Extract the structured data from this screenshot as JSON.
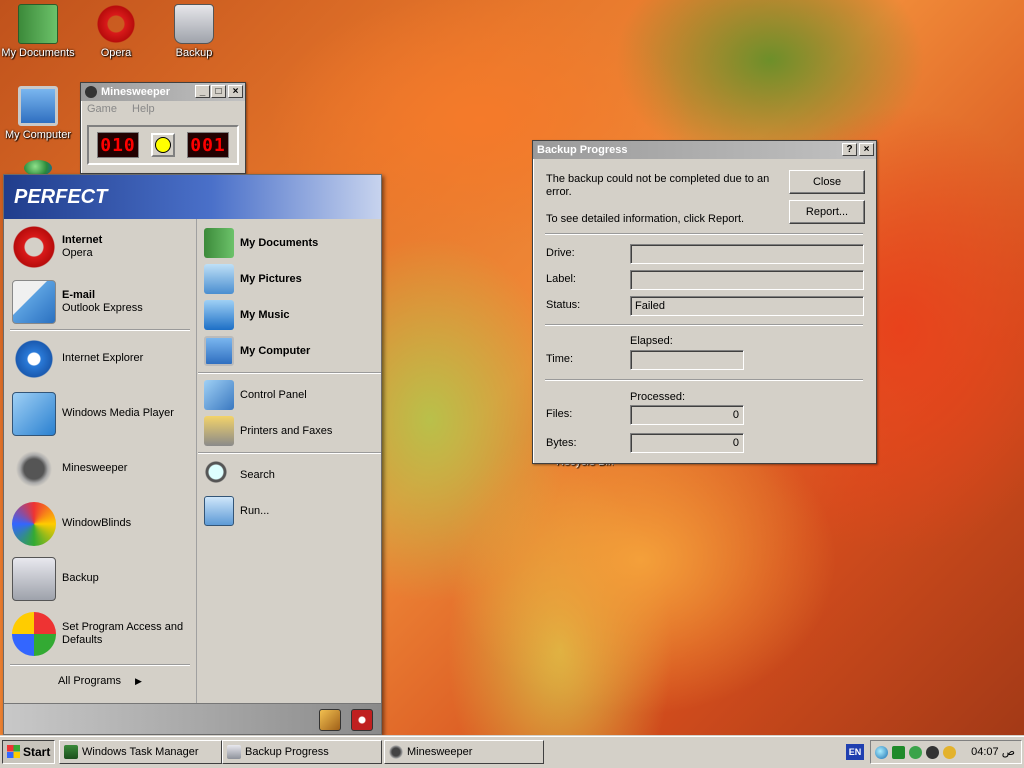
{
  "desktop": {
    "icons": [
      {
        "label": "My Documents"
      },
      {
        "label": "Opera"
      },
      {
        "label": "Backup"
      },
      {
        "label": "My Computer"
      }
    ],
    "hidden_icon_label": "Recycle Bin"
  },
  "minesweeper": {
    "title": "Minesweeper",
    "menu": [
      "Game",
      "Help"
    ],
    "mines_left": "010",
    "timer": "001"
  },
  "start_menu": {
    "header": "PERFECT",
    "pinned": [
      {
        "title": "Internet",
        "subtitle": "Opera",
        "icon": "opera-icon"
      },
      {
        "title": "E-mail",
        "subtitle": "Outlook Express",
        "icon": "outlook-express-icon"
      }
    ],
    "recent": [
      {
        "label": "Internet Explorer",
        "icon": "internet-explorer-icon"
      },
      {
        "label": "Windows Media Player",
        "icon": "media-player-icon"
      },
      {
        "label": "Minesweeper",
        "icon": "minesweeper-icon"
      },
      {
        "label": "WindowBlinds",
        "icon": "windowblinds-icon"
      },
      {
        "label": "Backup",
        "icon": "backup-icon"
      },
      {
        "label": "Set Program Access and Defaults",
        "icon": "program-defaults-icon"
      }
    ],
    "all_programs": "All Programs",
    "right_bold": [
      {
        "label": "My Documents",
        "icon": "my-documents-icon"
      },
      {
        "label": "My Pictures",
        "icon": "my-pictures-icon"
      },
      {
        "label": "My Music",
        "icon": "my-music-icon"
      },
      {
        "label": "My Computer",
        "icon": "my-computer-icon"
      }
    ],
    "right_settings": [
      {
        "label": "Control Panel",
        "icon": "control-panel-icon"
      },
      {
        "label": "Printers and Faxes",
        "icon": "printer-icon"
      }
    ],
    "right_tools": [
      {
        "label": "Search",
        "icon": "search-icon"
      },
      {
        "label": "Run...",
        "icon": "run-icon"
      }
    ]
  },
  "backup_dialog": {
    "title": "Backup Progress",
    "message": "The backup could not be completed due to an error.",
    "hint": "To see detailed information, click Report.",
    "close_button": "Close",
    "report_button": "Report...",
    "drive_label": "Drive:",
    "drive_value": "",
    "label_label": "Label:",
    "label_value": "",
    "status_label": "Status:",
    "status_value": "Failed",
    "elapsed_label": "Elapsed:",
    "time_label": "Time:",
    "time_value": "",
    "processed_label": "Processed:",
    "files_label": "Files:",
    "files_value": "0",
    "bytes_label": "Bytes:",
    "bytes_value": "0"
  },
  "taskbar": {
    "start_label": "Start",
    "tasks": [
      {
        "label": "Windows Task Manager"
      },
      {
        "label": "Backup Progress"
      },
      {
        "label": "Minesweeper"
      }
    ],
    "language": "EN",
    "clock": "04:07 ص"
  }
}
